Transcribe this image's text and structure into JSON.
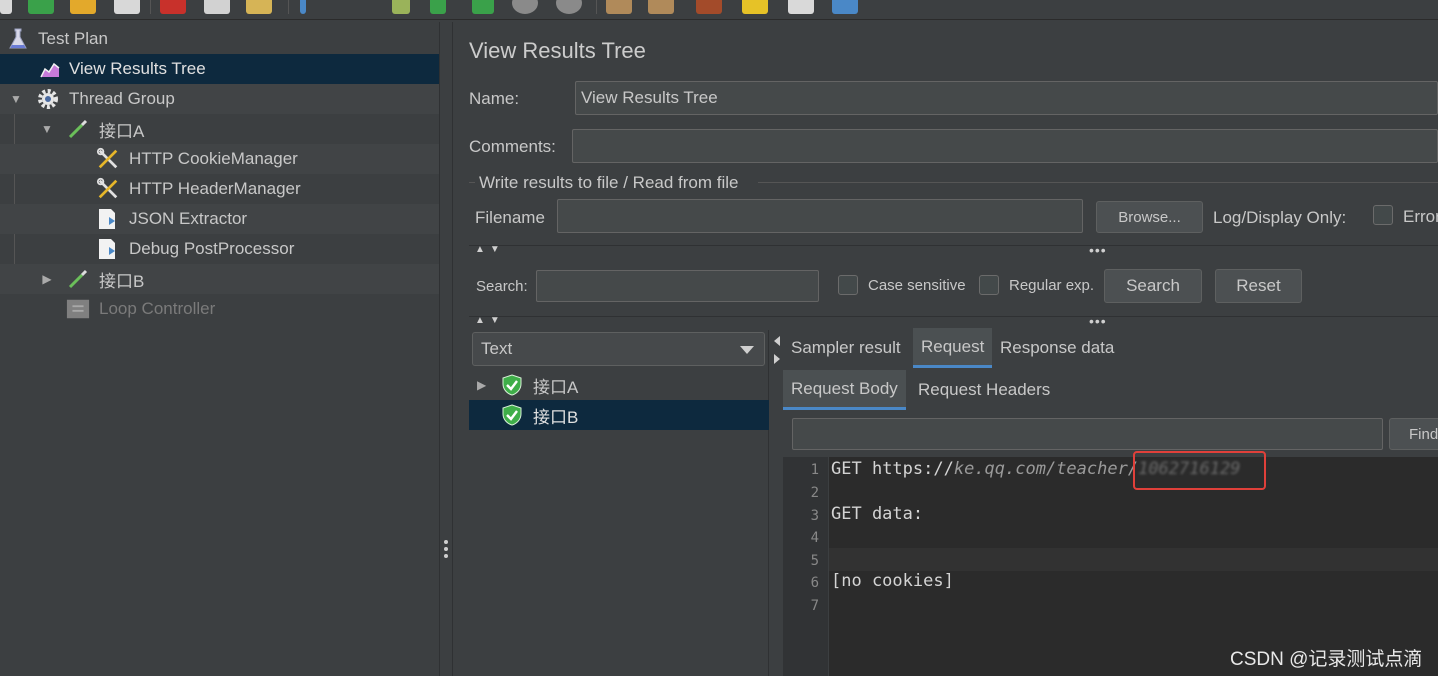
{
  "toolbar": {
    "icons": [
      "new-icon",
      "templates-icon",
      "open-icon",
      "save-icon",
      "cut-icon",
      "copy-icon",
      "paste-icon",
      "expand-icon",
      "toggle-icon",
      "start-icon",
      "start-no-pause-icon",
      "stop-icon",
      "shutdown-icon",
      "clear-icon",
      "clear-all-icon",
      "search-icon",
      "reset-search-icon",
      "function-helper-icon",
      "help-icon"
    ]
  },
  "tree": {
    "items": [
      {
        "label": "Test Plan",
        "icon": "flask-icon"
      },
      {
        "label": "View Results Tree",
        "icon": "chart-icon"
      },
      {
        "label": "Thread Group",
        "icon": "gear-icon"
      },
      {
        "label": "接口A",
        "icon": "pipette-icon"
      },
      {
        "label": "HTTP CookieManager",
        "icon": "tools-icon"
      },
      {
        "label": "HTTP HeaderManager",
        "icon": "tools-icon"
      },
      {
        "label": "JSON Extractor",
        "icon": "document-icon"
      },
      {
        "label": "Debug PostProcessor",
        "icon": "document-icon"
      },
      {
        "label": "接口B",
        "icon": "pipette-icon"
      },
      {
        "label": "Loop Controller",
        "icon": "loop-icon"
      }
    ]
  },
  "panel": {
    "title": "View Results Tree",
    "name_label": "Name:",
    "name_value": "View Results Tree",
    "comments_label": "Comments:",
    "comments_value": "",
    "file_group_label": "Write results to file / Read from file",
    "filename_label": "Filename",
    "filename_value": "",
    "browse_label": "Browse...",
    "log_display_label": "Log/Display Only:",
    "errors_label": "Errors"
  },
  "search": {
    "label": "Search:",
    "value": "",
    "case_sensitive_label": "Case sensitive",
    "regular_exp_label": "Regular exp.",
    "search_button": "Search",
    "reset_button": "Reset"
  },
  "results": {
    "renderer": "Text",
    "items": [
      {
        "label": "接口A",
        "status": "success"
      },
      {
        "label": "接口B",
        "status": "success"
      }
    ]
  },
  "detail": {
    "tabs": [
      "Sampler result",
      "Request",
      "Response data"
    ],
    "active_tab": "Request",
    "subtabs": [
      "Request Body",
      "Request Headers"
    ],
    "active_subtab": "Request Body",
    "find_label": "Find",
    "line_numbers": [
      "1",
      "2",
      "3",
      "4",
      "5",
      "6",
      "7"
    ],
    "code": {
      "line1_method": "GET ",
      "line1_url_plain": "https://",
      "line1_url_host": "ke.qq.com/teacher/",
      "line1_url_hidden": "1062716129",
      "line3": "GET data:",
      "line6": "[no cookies]"
    }
  },
  "watermark": "CSDN @记录测试点滴",
  "colors": {
    "background": "#3c3f41",
    "selection": "#0d293e",
    "editor_bg": "#2b2b2b",
    "accent": "#4a88c7",
    "annotation_red": "#e0403a",
    "success_green": "#3fae49"
  }
}
